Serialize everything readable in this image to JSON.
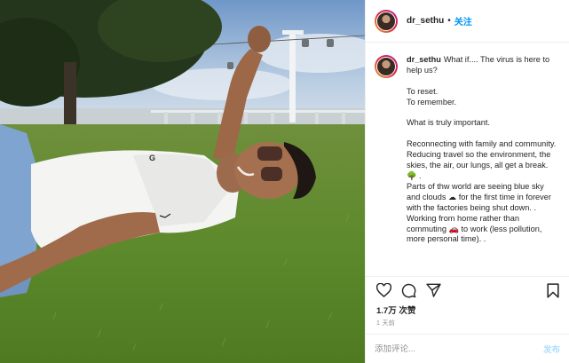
{
  "post": {
    "username": "dr_sethu",
    "separator": "•",
    "follow_label": "关注",
    "caption_user": "dr_sethu",
    "caption_text": "What if.... The virus is here to help us?\n\nTo reset.\nTo remember.\n\nWhat is truly important.\n\nReconnecting with family and community.\nReducing travel so the environment, the skies, the air, our lungs, all get a break. 🌳 .\nParts of thw world are seeing blue sky and clouds ☁ for the first time in forever with the factories being shut down. .\nWorking from home rather than commuting 🚗 to work (less pollution, more personal time). .",
    "likes": "1.7万 次赞",
    "time": "1 天前",
    "comment_placeholder": "添加评论...",
    "post_button": "发布"
  },
  "icons": {
    "like": "heart-icon",
    "comment": "comment-icon",
    "share": "paper-plane-icon",
    "save": "bookmark-icon"
  },
  "colors": {
    "follow_blue": "#0095f6",
    "post_button_disabled": "#b2dffc",
    "muted_text": "#8e8e8e"
  }
}
